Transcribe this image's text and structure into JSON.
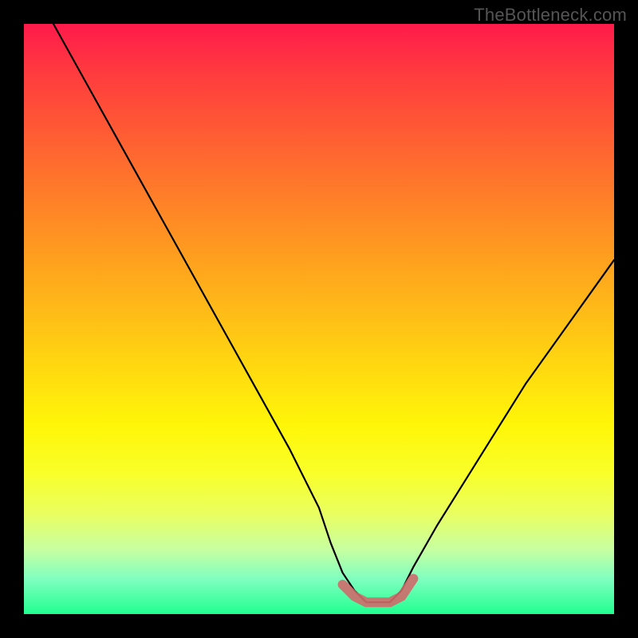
{
  "watermark": "TheBottleneck.com",
  "chart_data": {
    "type": "line",
    "title": "",
    "xlabel": "",
    "ylabel": "",
    "xlim": [
      0,
      100
    ],
    "ylim": [
      0,
      100
    ],
    "series": [
      {
        "name": "bottleneck-curve",
        "x": [
          5,
          10,
          15,
          20,
          25,
          30,
          35,
          40,
          45,
          50,
          52,
          54,
          56,
          58,
          60,
          62,
          64,
          66,
          70,
          75,
          80,
          85,
          90,
          95,
          100
        ],
        "y": [
          100,
          91,
          82,
          73,
          64,
          55,
          46,
          37,
          28,
          18,
          12,
          7,
          4,
          2,
          2,
          2,
          4,
          8,
          15,
          23,
          31,
          39,
          46,
          53,
          60
        ]
      },
      {
        "name": "highlight-band",
        "x": [
          54,
          56,
          58,
          60,
          62,
          64,
          66
        ],
        "y": [
          5,
          3,
          2,
          2,
          2,
          3,
          6
        ]
      }
    ],
    "colors": {
      "curve": "#000000",
      "highlight": "#cf6a6a",
      "gradient_top": "#ff1a4b",
      "gradient_bottom": "#20ff90"
    },
    "annotations": []
  }
}
